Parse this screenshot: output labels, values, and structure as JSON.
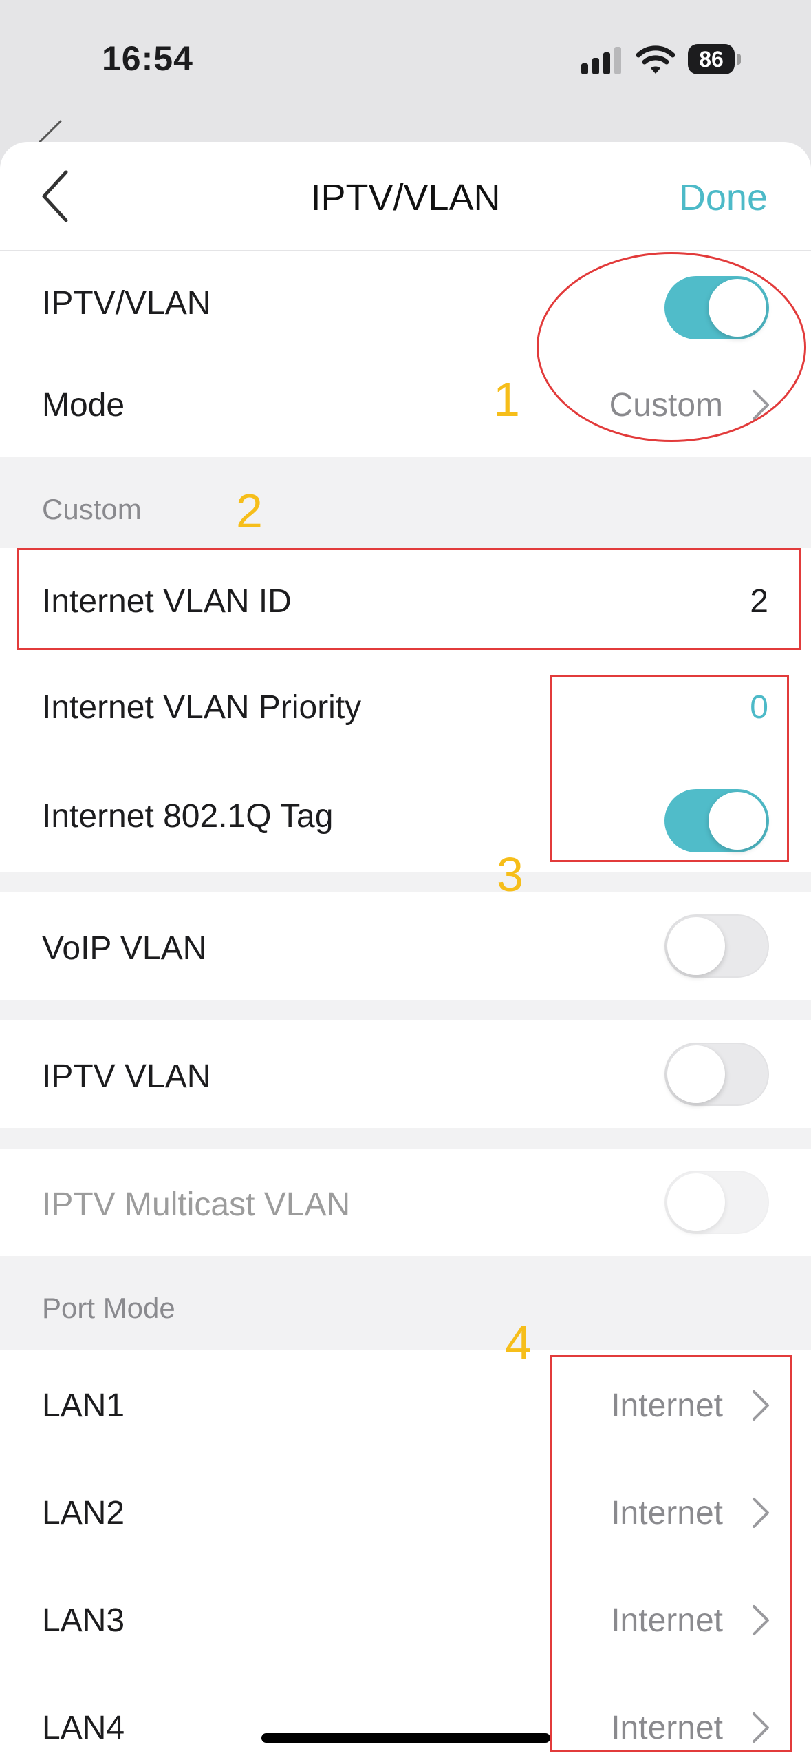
{
  "status_bar": {
    "time": "16:54",
    "battery": "86"
  },
  "nav": {
    "title": "IPTV/VLAN",
    "done_label": "Done"
  },
  "top_section": {
    "iptv_vlan_label": "IPTV/VLAN",
    "iptv_vlan_on": true,
    "mode_label": "Mode",
    "mode_value": "Custom"
  },
  "custom_section": {
    "header": "Custom",
    "internet_vlan_id_label": "Internet VLAN ID",
    "internet_vlan_id_value": "2",
    "internet_vlan_priority_label": "Internet VLAN Priority",
    "internet_vlan_priority_value": "0",
    "internet_8021q_label": "Internet 802.1Q Tag",
    "internet_8021q_on": true
  },
  "voip": {
    "label": "VoIP VLAN",
    "on": false
  },
  "iptv_vlan": {
    "label": "IPTV VLAN",
    "on": false
  },
  "iptv_multicast": {
    "label": "IPTV Multicast VLAN",
    "on": false,
    "disabled": true
  },
  "port_mode": {
    "header": "Port Mode",
    "ports": [
      {
        "label": "LAN1",
        "value": "Internet"
      },
      {
        "label": "LAN2",
        "value": "Internet"
      },
      {
        "label": "LAN3",
        "value": "Internet"
      },
      {
        "label": "LAN4",
        "value": "Internet"
      }
    ]
  },
  "annotations": {
    "n1": "1",
    "n2": "2",
    "n3": "3",
    "n4": "4"
  },
  "colors": {
    "accent": "#4dbac8",
    "annotation_red": "#e23b3b",
    "annotation_yellow": "#f6be1a"
  }
}
